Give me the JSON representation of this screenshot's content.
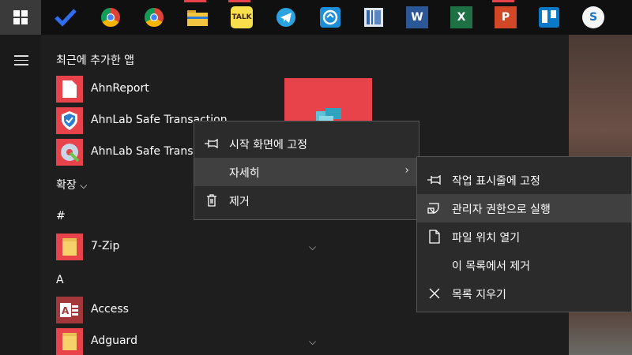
{
  "taskbar": {
    "icons": [
      {
        "name": "todo",
        "label": "",
        "color": "#2e6ef0"
      },
      {
        "name": "chrome-1",
        "label": "",
        "color": "#e0e0e0"
      },
      {
        "name": "chrome-2",
        "label": "",
        "color": "#e0e0e0"
      },
      {
        "name": "file-explorer",
        "label": "",
        "color": "#f0c040"
      },
      {
        "name": "kakaotalk",
        "label": "TALK",
        "color": "#f7e04b"
      },
      {
        "name": "telegram",
        "label": "",
        "color": "#2aa3e0"
      },
      {
        "name": "app-circle",
        "label": "",
        "color": "#1d8fd8"
      },
      {
        "name": "app-book",
        "label": "",
        "color": "#dfe6ee"
      },
      {
        "name": "word",
        "label": "W",
        "color": "#2b5797"
      },
      {
        "name": "excel",
        "label": "X",
        "color": "#1e7145"
      },
      {
        "name": "powerpoint",
        "label": "P",
        "color": "#d24726"
      },
      {
        "name": "trello",
        "label": "",
        "color": "#0a7ac8"
      },
      {
        "name": "simplenote",
        "label": "S",
        "color": "#f5f5f5"
      }
    ]
  },
  "start": {
    "section_title": "최근에 추가한 앱",
    "expand_label": "확장",
    "expand_chevron": "⌵",
    "letter_hash": "#",
    "letter_a": "A",
    "apps": [
      {
        "label": "AhnReport"
      },
      {
        "label": "AhnLab Safe Transaction"
      },
      {
        "label": "AhnLab Safe Transaction"
      },
      {
        "label": "7-Zip",
        "chevron": "⌵"
      },
      {
        "label": "Access"
      },
      {
        "label": "Adguard",
        "chevron": "⌵"
      }
    ]
  },
  "context_menu": {
    "items": [
      {
        "label": "시작 화면에 고정",
        "icon": "pin-icon"
      },
      {
        "label": "자세히",
        "icon": "",
        "arrow": "›"
      },
      {
        "label": "제거",
        "icon": "trash-icon"
      }
    ]
  },
  "sub_menu": {
    "items": [
      {
        "label": "작업 표시줄에 고정",
        "icon": "pin-icon"
      },
      {
        "label": "관리자 권한으로 실행",
        "icon": "shield-icon"
      },
      {
        "label": "파일 위치 열기",
        "icon": "file-icon"
      },
      {
        "label": "이 목록에서 제거",
        "icon": ""
      },
      {
        "label": "목록 지우기",
        "icon": "close-icon"
      }
    ]
  },
  "colors": {
    "tile_red": "#e8424a",
    "menu_bg": "#2b2b2b",
    "menu_highlight": "#404040"
  }
}
